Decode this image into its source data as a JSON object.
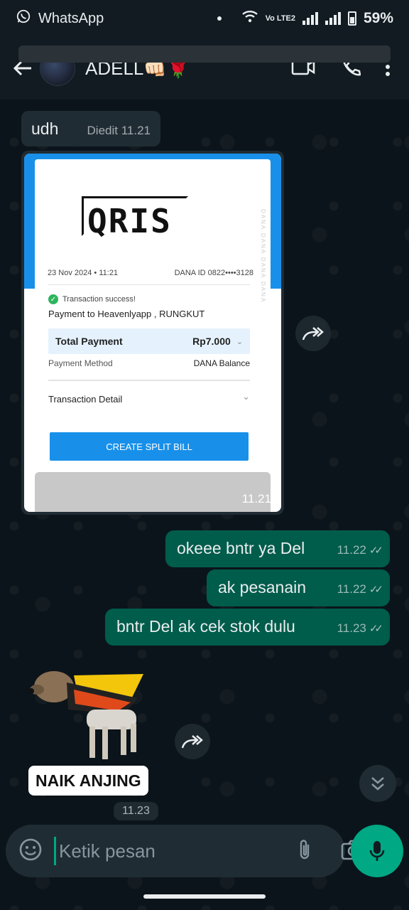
{
  "status_bar": {
    "app_name": "WhatsApp",
    "network": "Vo LTE2",
    "battery": "59%"
  },
  "header": {
    "contact_name": "ADELL👊🏻🌹"
  },
  "messages": {
    "incoming_text": {
      "text": "udh",
      "meta": "Diedit 11.21"
    },
    "receipt": {
      "date": "23 Nov 2024 • 11:21",
      "dana_id": "DANA ID 0822••••3128",
      "status": "Transaction success!",
      "payment_to": "Payment to Heavenlyapp , RUNGKUT",
      "total_label": "Total Payment",
      "total_value": "Rp7.000",
      "method_label": "Payment Method",
      "method_value": "DANA Balance",
      "detail_label": "Transaction Detail",
      "split_button": "CREATE SPLIT BILL",
      "logo_text": "QRIS",
      "time": "11.21"
    },
    "outgoing": [
      {
        "text": "okeee bntr ya Del",
        "time": "11.22"
      },
      {
        "text": "ak pesanain",
        "time": "11.22"
      },
      {
        "text": "bntr Del ak cek stok dulu",
        "time": "11.23"
      }
    ],
    "sticker": {
      "label": "NAIK ANJING",
      "time": "11.23"
    }
  },
  "composer": {
    "placeholder": "Ketik pesan"
  },
  "icons": [
    "whatsapp-icon",
    "wifi-icon",
    "signal-icon",
    "battery-icon",
    "back-arrow-icon",
    "video-call-icon",
    "phone-icon",
    "more-vert-icon",
    "forward-icon",
    "double-chevron-down-icon",
    "emoji-icon",
    "attach-icon",
    "camera-icon",
    "mic-icon"
  ],
  "colors": {
    "bg": "#0b141a",
    "incoming_bubble": "#202c33",
    "outgoing_bubble": "#005c4b",
    "accent": "#00a884"
  }
}
